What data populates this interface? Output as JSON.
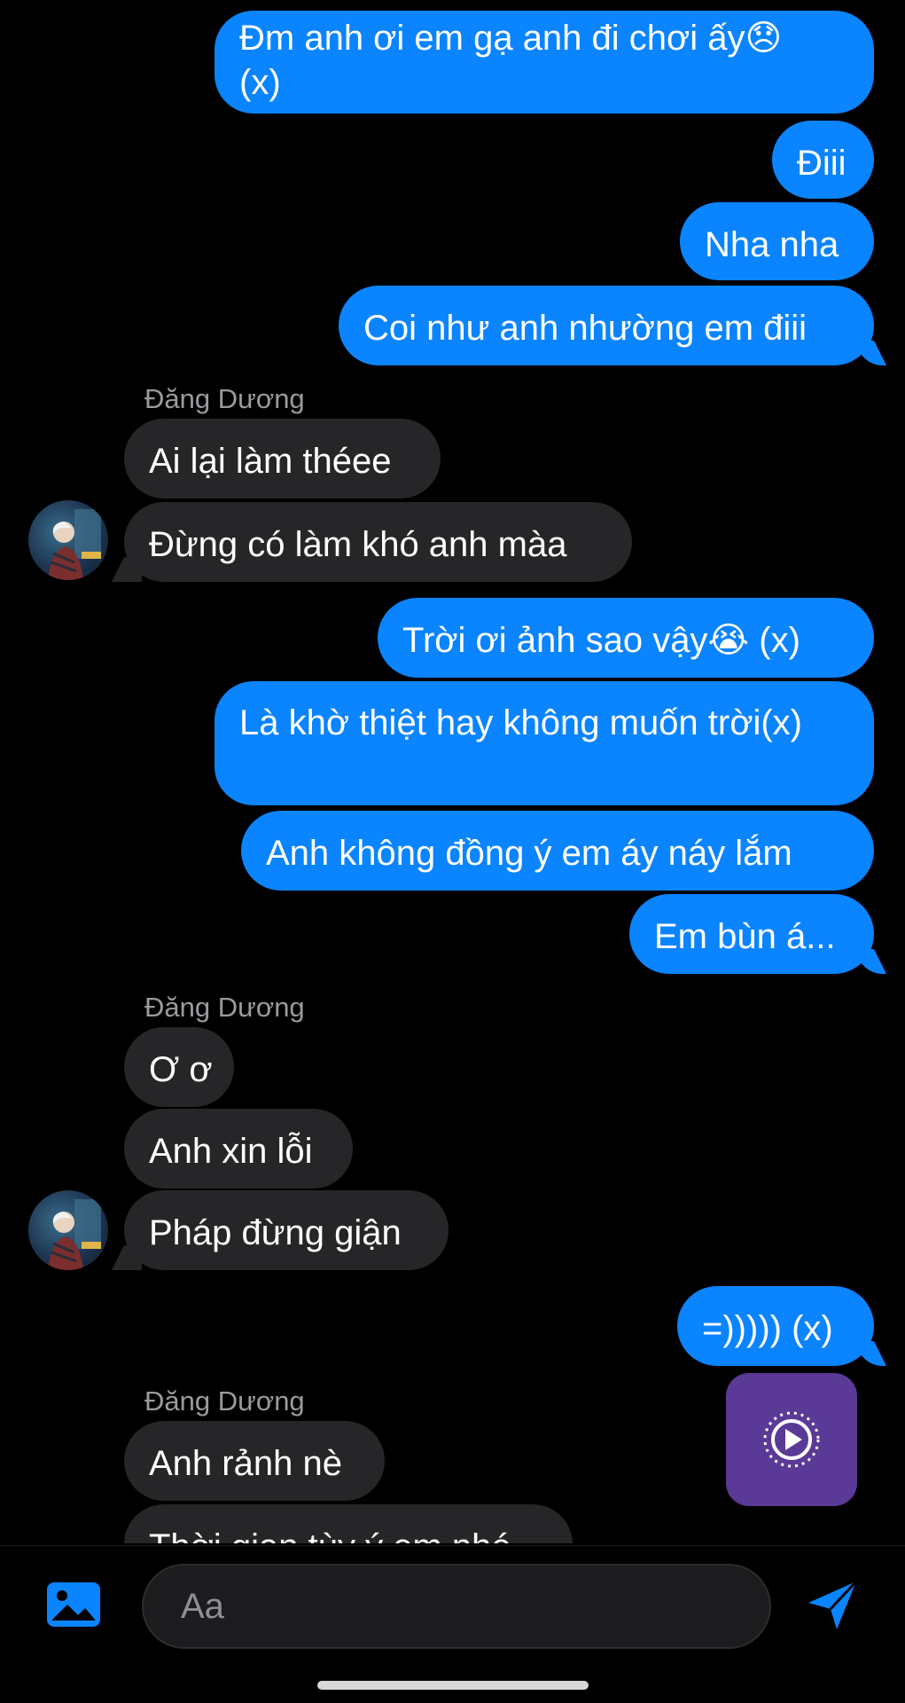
{
  "messages": [
    {
      "id": "m1",
      "text": "Đm anh ơi em gạ anh đi chơi ấy😞\n(x)"
    },
    {
      "id": "m2",
      "text": "Điii"
    },
    {
      "id": "m3",
      "text": "Nha nha"
    },
    {
      "id": "m4",
      "text": "Coi như anh nhường em điii"
    },
    {
      "id": "m5",
      "text": "Ai lại làm théee"
    },
    {
      "id": "m6",
      "text": "Đừng có làm khó anh màa"
    },
    {
      "id": "m7",
      "text": "Trời ơi ảnh sao vậy😭 (x)"
    },
    {
      "id": "m8",
      "text": "Là khờ thiệt hay không muốn trời(x)"
    },
    {
      "id": "m9",
      "text": "Anh không đồng ý em áy náy lắm"
    },
    {
      "id": "m10",
      "text": "Em bùn á..."
    },
    {
      "id": "m11",
      "text": "Ơ ơ"
    },
    {
      "id": "m12",
      "text": "Anh xin lỗi"
    },
    {
      "id": "m13",
      "text": "Pháp đừng giận"
    },
    {
      "id": "m14",
      "text": "=))))) (x)"
    },
    {
      "id": "m15",
      "text": "Anh rảnh nè"
    },
    {
      "id": "m16",
      "text": "Thời gian tùy ý em nhé"
    }
  ],
  "sender_name": "Đăng Dương",
  "composer": {
    "placeholder": "Aa"
  },
  "colors": {
    "outgoing": "#0a84ff",
    "incoming": "#262628",
    "media_card": "#5a3a96"
  },
  "icons": {
    "gallery": "image-icon",
    "send": "send-icon",
    "media": "play-circle-icon"
  }
}
